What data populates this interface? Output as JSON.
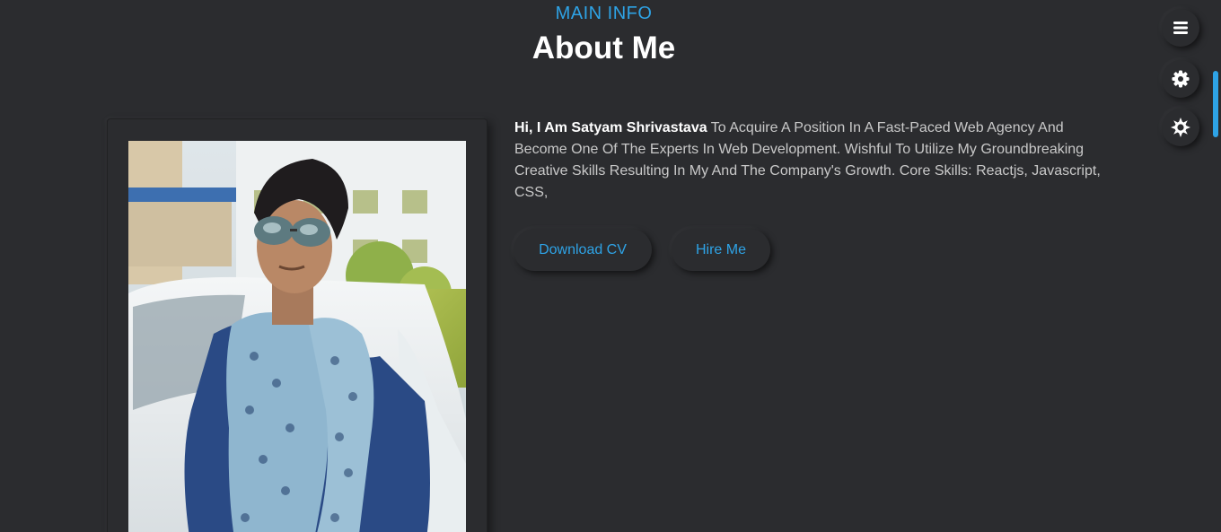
{
  "section": {
    "eyebrow": "MAIN INFO",
    "title": "About Me"
  },
  "bio": {
    "name_intro": "Hi, I Am Satyam Shrivastava",
    "text": " To Acquire A Position In A Fast-Paced Web Agency And Become One Of The Experts In Web Development. Wishful To Utilize My Groundbreaking Creative Skills Resulting In My And The Company's Growth. Core Skills: Reactjs, Javascript, CSS,"
  },
  "buttons": {
    "download_cv": "Download CV",
    "hire_me": "Hire Me"
  },
  "side_controls": [
    {
      "icon": "menu-icon"
    },
    {
      "icon": "gear-icon"
    },
    {
      "icon": "sun-icon"
    }
  ],
  "colors": {
    "background": "#2b2c2f",
    "accent": "#2ea3e6",
    "text": "#ffffff",
    "muted_text": "#c9c9c9"
  }
}
